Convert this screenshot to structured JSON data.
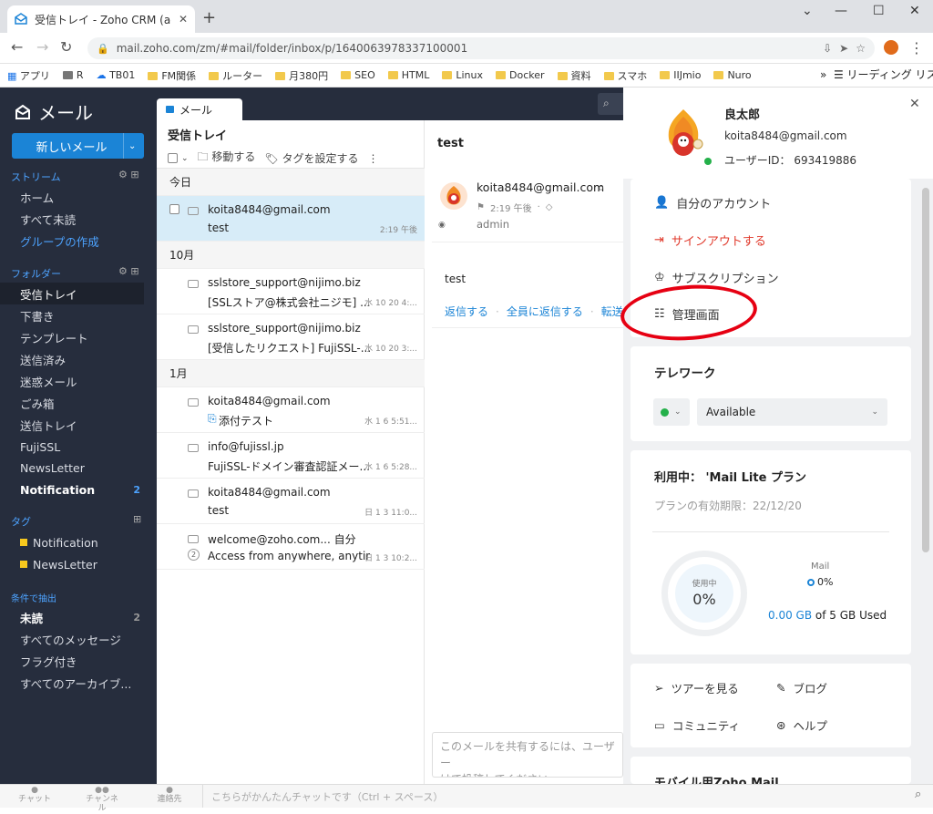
{
  "browser": {
    "tab_title": "受信トレイ - Zoho CRM (admin@",
    "url": "mail.zoho.com/zm/#mail/folder/inbox/p/1640063978337100001",
    "bookmarks": [
      "アプリ",
      "R",
      "TB01",
      "FM関係",
      "ルーター",
      "月380円",
      "SEO",
      "HTML",
      "Linux",
      "Docker",
      "資料",
      "スマホ",
      "IIJmio",
      "Nuro"
    ],
    "reading_list": "リーディング リスト"
  },
  "sidebar": {
    "brand": "メール",
    "new_mail": "新しいメール",
    "stream_header": "ストリーム",
    "stream_items": [
      "ホーム",
      "すべて未読",
      "グループの作成"
    ],
    "folder_header": "フォルダー",
    "folders": [
      "受信トレイ",
      "下書き",
      "テンプレート",
      "送信済み",
      "迷惑メール",
      "ごみ箱",
      "送信トレイ",
      "FujiSSL",
      "NewsLetter",
      "Notification"
    ],
    "notification_count": "2",
    "tag_header": "タグ",
    "tags": [
      "Notification",
      "NewsLetter"
    ],
    "filter_header": "条件で抽出",
    "filters": [
      "未読",
      "すべてのメッセージ",
      "フラグ付き",
      "すべてのアーカイブ..."
    ],
    "unread_count": "2"
  },
  "list": {
    "tab_label": "メール",
    "title": "受信トレイ",
    "move_label": "移動する",
    "tag_label": "タグを設定する",
    "groups": {
      "today": "今日",
      "oct": "10月",
      "jan": "1月"
    },
    "rows": [
      {
        "from": "koita8484@gmail.com",
        "subject": "test",
        "date": "2:19 午後"
      },
      {
        "from": "sslstore_support@nijimo.biz",
        "subject": "[SSLストア@株式会社ニジモ] ...",
        "date": "水 10 20 4:..."
      },
      {
        "from": "sslstore_support@nijimo.biz",
        "subject": "[受信したリクエスト] FujiSSL-...",
        "date": "水 10 20 3:..."
      },
      {
        "from": "koita8484@gmail.com",
        "subject": "添付テスト",
        "date": "水 1 6 5:51..."
      },
      {
        "from": "info@fujissl.jp",
        "subject": "FujiSSL-ドメイン審査認証メー...",
        "date": "水 1 6 5:28..."
      },
      {
        "from": "koita8484@gmail.com",
        "subject": "test",
        "date": "日 1 3 11:0..."
      },
      {
        "from": "welcome@zoho.com... 自分",
        "subject": "Access from anywhere, anytime!",
        "date": "日 1 3 10:2...",
        "count": "2"
      }
    ]
  },
  "reading": {
    "subject": "test",
    "from": "koita8484@gmail.com",
    "time": "2:19 午後",
    "to": "admin",
    "body": "test",
    "reply": "返信する",
    "reply_all": "全員に返信する",
    "forward": "転送",
    "share_placeholder": "このメールを共有するには、ユーザー\nけて投稿してください"
  },
  "panel": {
    "name": "良太郎",
    "email": "koita8484@gmail.com",
    "user_id": "ユーザーID： 693419886",
    "my_account": "自分のアカウント",
    "signout": "サインアウトする",
    "subscription": "サブスクリプション",
    "admin": "管理画面",
    "telework": "テレワーク",
    "status": "Available",
    "plan": "利用中： 'Mail Lite プラン",
    "plan_expiry": "プランの有効期限：22/12/20",
    "usage_label": "使用中",
    "usage_pct": "0%",
    "mail_label": "Mail",
    "mail_pct": "0%",
    "storage_used": "0.00 GB",
    "storage_rest": "of 5 GB Used",
    "tour": "ツアーを見る",
    "blog": "ブログ",
    "community": "コミュニティ",
    "help": "ヘルプ",
    "mobile": "モバイル用Zoho Mail"
  },
  "bottom": {
    "chat": "チャット",
    "channel": "チャンネル",
    "contacts": "連絡先",
    "chat_placeholder": "こちらがかんたんチャットです（Ctrl + スペース）"
  }
}
